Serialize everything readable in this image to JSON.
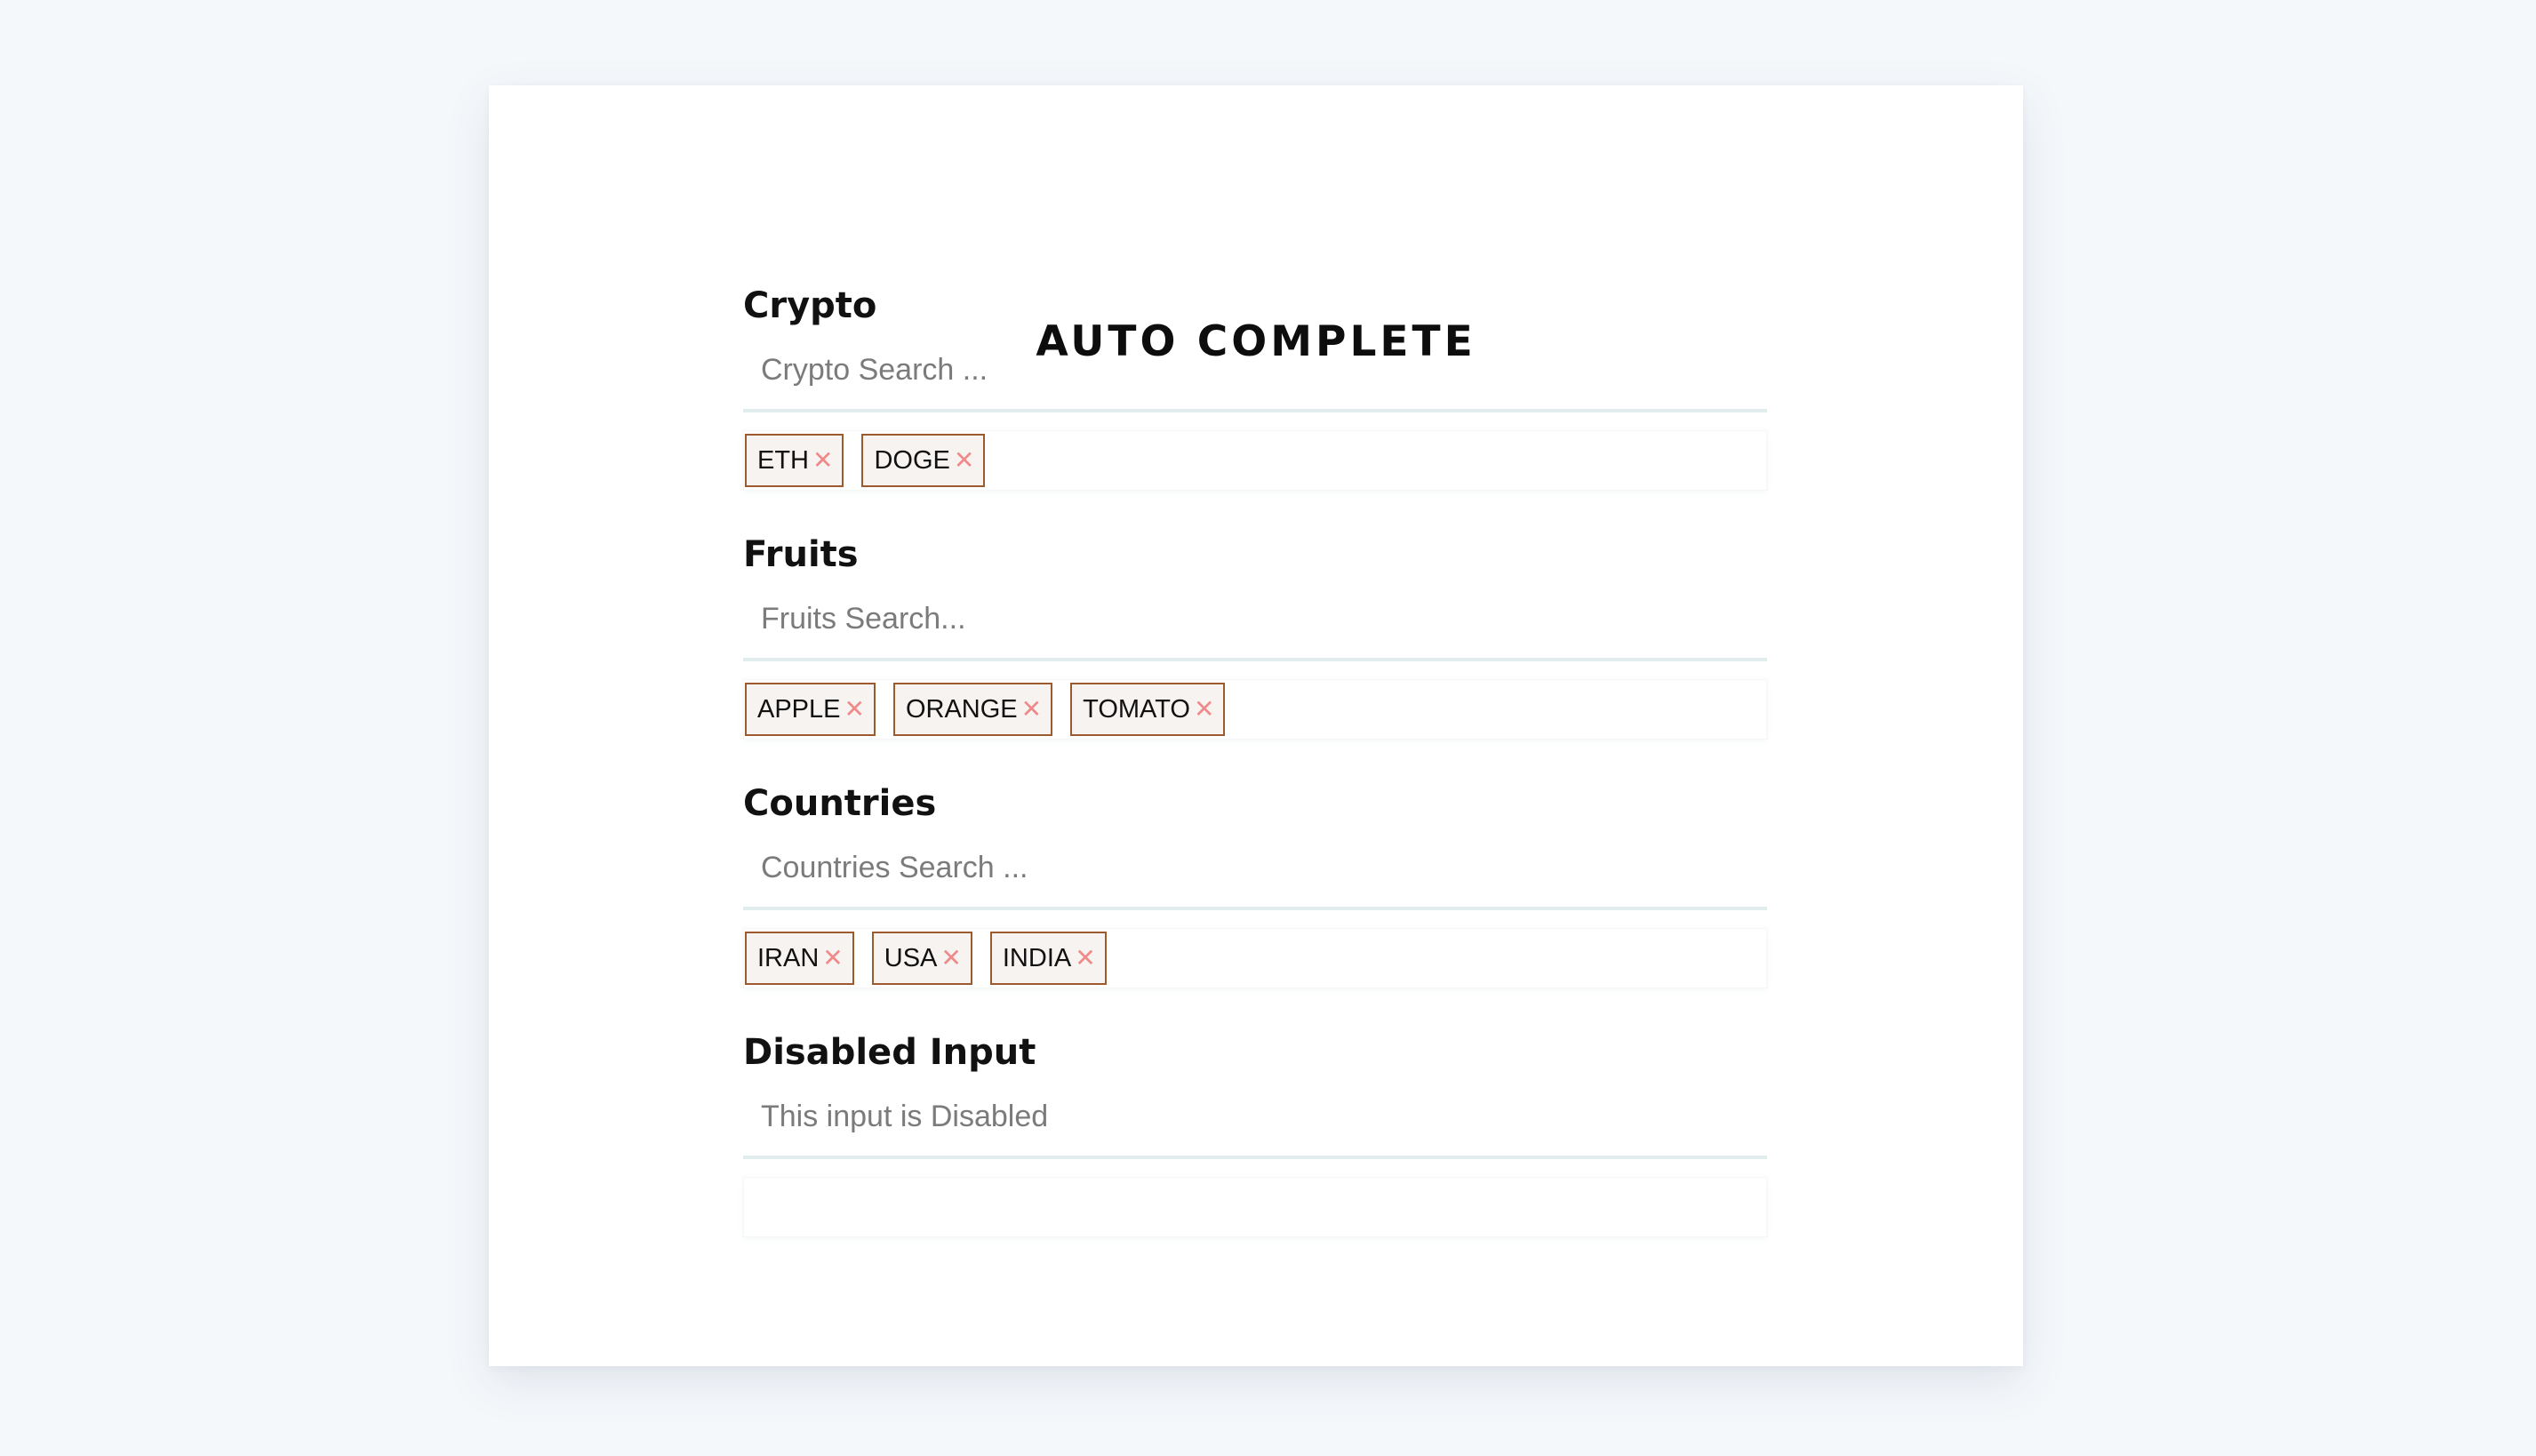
{
  "page": {
    "title": "AUTO COMPLETE"
  },
  "sections": [
    {
      "label": "Crypto",
      "placeholder": "Crypto Search ...",
      "chips": [
        "ETH",
        "DOGE"
      ]
    },
    {
      "label": "Fruits",
      "placeholder": "Fruits Search...",
      "chips": [
        "APPLE",
        "ORANGE",
        "TOMATO"
      ]
    },
    {
      "label": "Countries",
      "placeholder": "Countries Search ...",
      "chips": [
        "IRAN",
        "USA",
        "INDIA"
      ]
    },
    {
      "label": "Disabled Input",
      "placeholder": "This input is Disabled",
      "chips": []
    }
  ],
  "icons": {
    "chip_remove": "close-icon"
  },
  "colors": {
    "background": "#f5f8fb",
    "card": "#ffffff",
    "chip_border": "#9c5a2e",
    "chip_fill": "#f7f3f1",
    "remove_icon": "#f08a8a",
    "input_underline": "#e1ecef"
  }
}
